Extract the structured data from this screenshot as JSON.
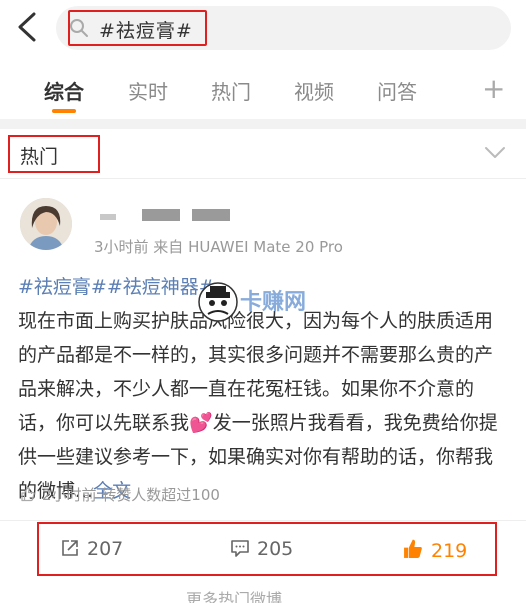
{
  "search": {
    "query": "#祛痘膏#"
  },
  "tabs": [
    {
      "label": "综合",
      "active": true
    },
    {
      "label": "实时"
    },
    {
      "label": "热门"
    },
    {
      "label": "视频"
    },
    {
      "label": "问答"
    }
  ],
  "section": {
    "title": "热门"
  },
  "post": {
    "meta": "3小时前  来自 HUAWEI Mate 20 Pro",
    "tags": "#祛痘膏##祛痘神器#",
    "body_1": "现在市面上购买护肤品风险很大，因为每个人的肤质适用的产品都是不一样的，其实很多问题并不需要那么贵的产品来解决，不少人都一直在花冤枉钱。如果你不介意的话，你可以先联系我",
    "body_2": "发一张照片我看看，我免费给你提供一些建议参考一下，如果确实对你有帮助的话，你帮我的微博...",
    "full_text": "全文",
    "like_note": "2小时前 转赞人数超过100",
    "reposts": "207",
    "comments": "205",
    "likes": "219"
  },
  "watermark": "卡赚网",
  "footer": {
    "more": "更多热门微博"
  },
  "colors": {
    "accent": "#ff8200",
    "link": "#5b7fb4",
    "highlight_box": "#e02020"
  }
}
